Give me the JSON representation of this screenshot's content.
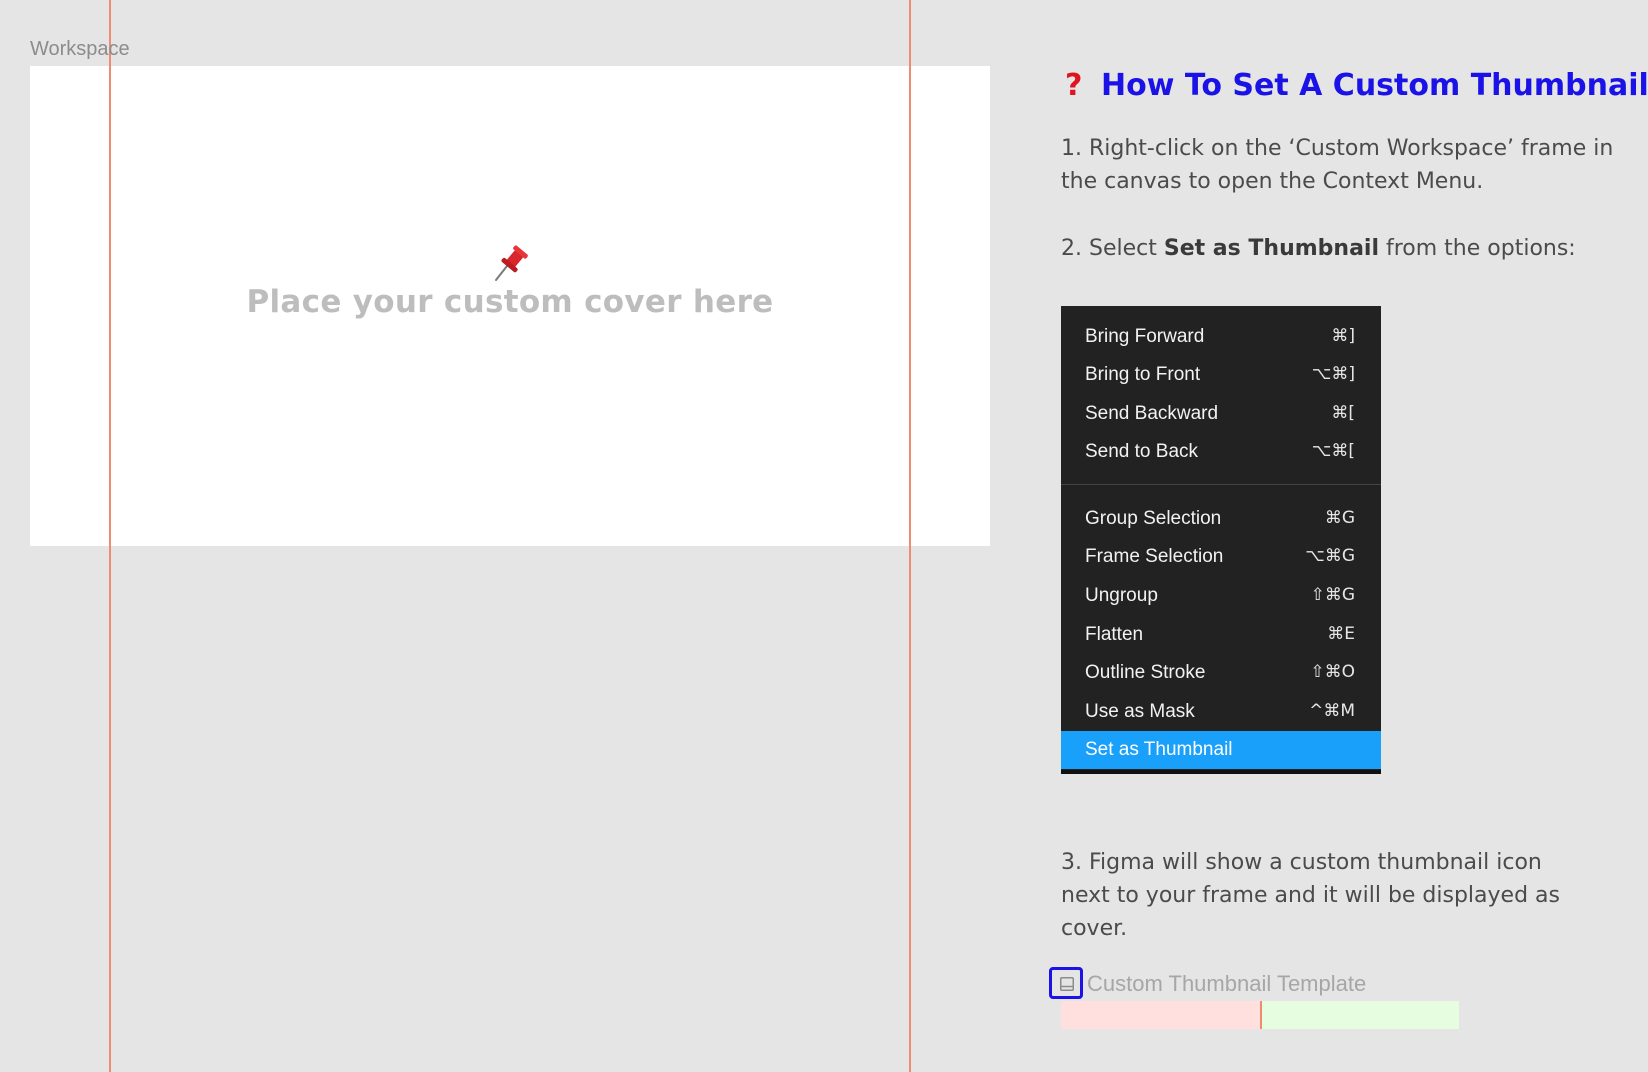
{
  "canvas": {
    "frame_label": "Workspace",
    "cover_placeholder": "Place your custom cover here",
    "pin_icon": "pushpin-icon"
  },
  "instructions": {
    "title": "How To Set A Custom Thumbnail?",
    "title_icon": "question-mark-icon",
    "step1": "1. Right-click on the ‘Custom Workspace’ frame in the canvas to open the Context Menu.",
    "step2_prefix": "2. Select ",
    "step2_bold": "Set as Thumbnail",
    "step2_suffix": " from the options:",
    "step3": "3. Figma will show a custom thumbnail icon next to your frame and it will be displayed as cover."
  },
  "context_menu": {
    "items": [
      {
        "label": "Bring Forward",
        "shortcut": "⌘]"
      },
      {
        "label": "Bring to Front",
        "shortcut": "⌥⌘]"
      },
      {
        "label": "Send Backward",
        "shortcut": "⌘["
      },
      {
        "label": "Send to Back",
        "shortcut": "⌥⌘["
      },
      {
        "label": "Group Selection",
        "shortcut": "⌘G"
      },
      {
        "label": "Frame Selection",
        "shortcut": "⌥⌘G"
      },
      {
        "label": "Ungroup",
        "shortcut": "⇧⌘G"
      },
      {
        "label": "Flatten",
        "shortcut": "⌘E"
      },
      {
        "label": "Outline Stroke",
        "shortcut": "⇧⌘O"
      },
      {
        "label": "Use as Mask",
        "shortcut": "^⌘M"
      },
      {
        "label": "Set as Thumbnail",
        "shortcut": ""
      }
    ],
    "highlighted_label": "Set as Thumbnail",
    "highlight_color": "#18a0fb"
  },
  "thumbnail_example": {
    "label": "Custom Thumbnail Template",
    "icon": "thumbnail-icon"
  },
  "colors": {
    "title": "#1a12e6",
    "question": "#e0141e",
    "guide": "#ef8a73"
  }
}
